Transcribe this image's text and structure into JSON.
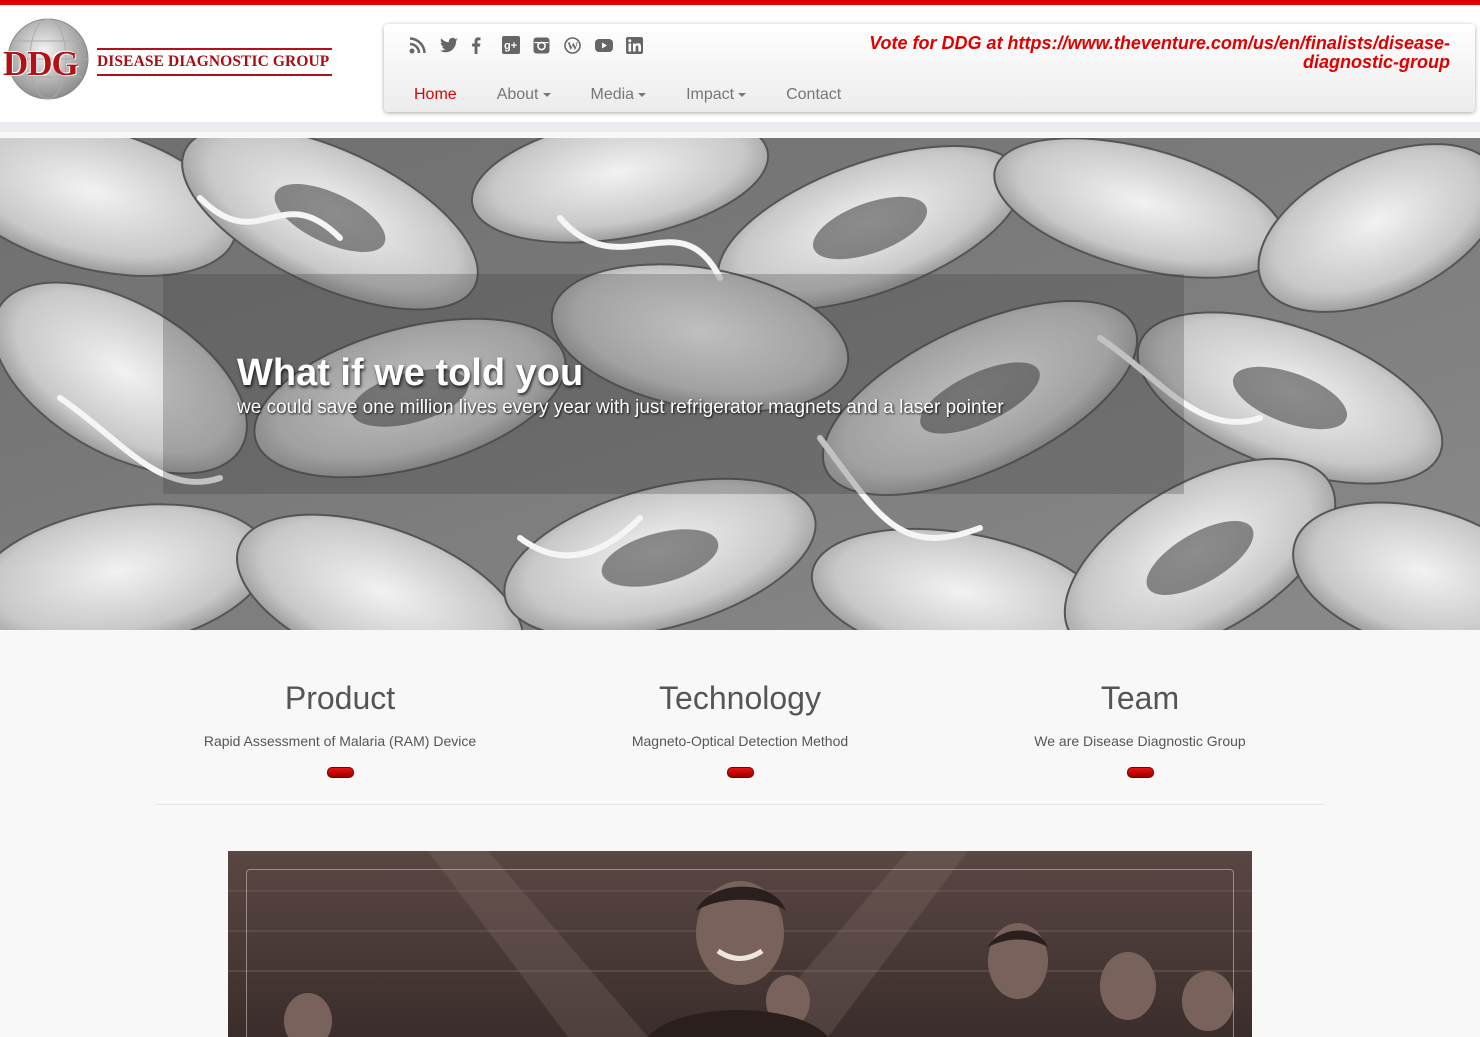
{
  "header": {
    "logo_text": "DISEASE DIAGNOSTIC GROUP",
    "logo_letters": "DDG",
    "vote_text": "Vote for DDG at https://www.theventure.com/us/en/finalists/disease-diagnostic-group",
    "social_icons": [
      "rss-icon",
      "twitter-icon",
      "facebook-icon",
      "google-plus-icon",
      "instagram-icon",
      "wordpress-icon",
      "youtube-icon",
      "linkedin-icon"
    ],
    "menu": [
      {
        "label": "Home",
        "dropdown": false,
        "active": true
      },
      {
        "label": "About",
        "dropdown": true,
        "active": false
      },
      {
        "label": "Media",
        "dropdown": true,
        "active": false
      },
      {
        "label": "Impact",
        "dropdown": true,
        "active": false
      },
      {
        "label": "Contact",
        "dropdown": false,
        "active": false
      }
    ]
  },
  "hero": {
    "title": "What if we told you",
    "subtitle": "we could save one million lives every year with just refrigerator magnets and a laser pointer"
  },
  "features": [
    {
      "title": "Product",
      "description": "Rapid Assessment of Malaria (RAM) Device"
    },
    {
      "title": "Technology",
      "description": "Magneto-Optical Detection Method"
    },
    {
      "title": "Team",
      "description": "We are Disease Diagnostic Group"
    }
  ],
  "colors": {
    "accent": "#e00000",
    "logo_red": "#a80d14",
    "nav_text": "#777777"
  }
}
